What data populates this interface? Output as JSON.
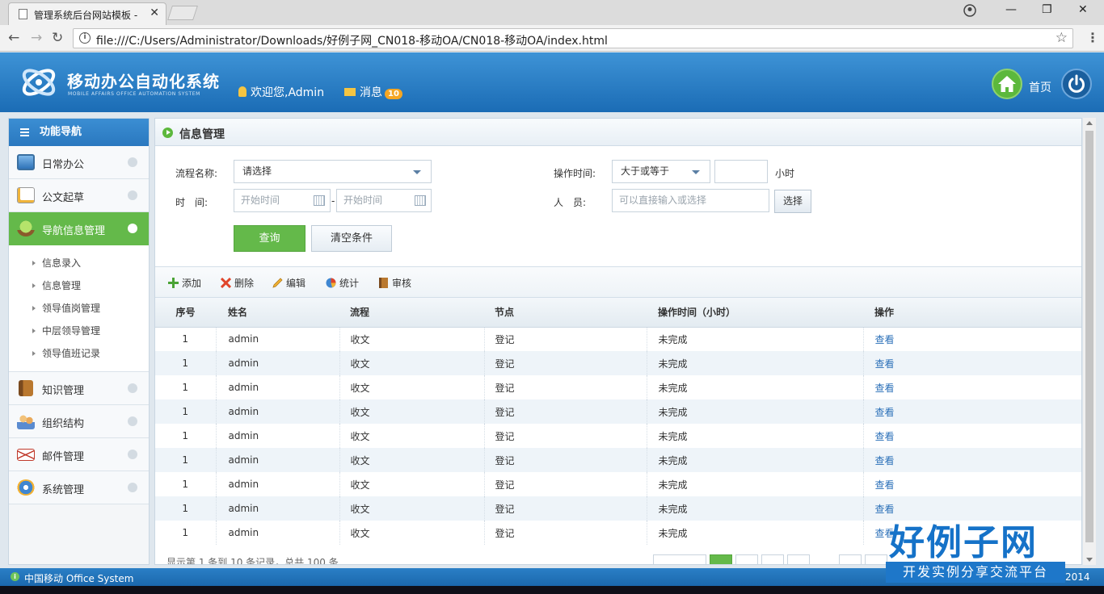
{
  "browser": {
    "tab_title": "管理系统后台网站模板 -",
    "url": "file:///C:/Users/Administrator/Downloads/好例子网_CN018-移动OA/CN018-移动OA/index.html"
  },
  "header": {
    "logo_title": "移动办公自动化系统",
    "logo_subtitle": "MOBILE AFFAIRS OFFICE AUTOMATION SYSTEM",
    "welcome": "欢迎您,Admin",
    "message_label": "消息",
    "message_count": "10",
    "home_label": "首页"
  },
  "sidebar": {
    "title": "功能导航",
    "items": [
      {
        "label": "日常办公",
        "icon": "monitor-icon"
      },
      {
        "label": "公文起草",
        "icon": "pencil-note-icon"
      },
      {
        "label": "导航信息管理",
        "icon": "tree-icon",
        "active": true
      },
      {
        "label": "知识管理",
        "icon": "book-icon"
      },
      {
        "label": "组织结构",
        "icon": "users-icon"
      },
      {
        "label": "邮件管理",
        "icon": "mail-icon"
      },
      {
        "label": "系统管理",
        "icon": "gear-icon"
      }
    ],
    "subitems": [
      "信息录入",
      "信息管理",
      "领导值岗管理",
      "中层领导管理",
      "领导值班记录"
    ]
  },
  "main": {
    "title": "信息管理",
    "form": {
      "flow_label": "流程名称:",
      "flow_value": "请选择",
      "time_label": "时　间:",
      "start_placeholder": "开始时间",
      "dash": "-",
      "end_placeholder": "开始时间",
      "optime_label": "操作时间:",
      "optime_value": "大于或等于",
      "hours_unit": "小时",
      "person_label": "人　员:",
      "person_placeholder": "可以直接输入或选择",
      "choose_button": "选择",
      "query_button": "查询",
      "clear_button": "清空条件"
    },
    "toolbar": {
      "add": "添加",
      "delete": "删除",
      "edit": "编辑",
      "stats": "统计",
      "review": "审核"
    },
    "table": {
      "headers": [
        "序号",
        "姓名",
        "流程",
        "节点",
        "操作时间（小时）",
        "操作"
      ],
      "rows": [
        {
          "no": "1",
          "name": "admin",
          "flow": "收文",
          "node": "登记",
          "time": "未完成",
          "op": "查看"
        },
        {
          "no": "1",
          "name": "admin",
          "flow": "收文",
          "node": "登记",
          "time": "未完成",
          "op": "查看"
        },
        {
          "no": "1",
          "name": "admin",
          "flow": "收文",
          "node": "登记",
          "time": "未完成",
          "op": "查看"
        },
        {
          "no": "1",
          "name": "admin",
          "flow": "收文",
          "node": "登记",
          "time": "未完成",
          "op": "查看"
        },
        {
          "no": "1",
          "name": "admin",
          "flow": "收文",
          "node": "登记",
          "time": "未完成",
          "op": "查看"
        },
        {
          "no": "1",
          "name": "admin",
          "flow": "收文",
          "node": "登记",
          "time": "未完成",
          "op": "查看"
        },
        {
          "no": "1",
          "name": "admin",
          "flow": "收文",
          "node": "登记",
          "time": "未完成",
          "op": "查看"
        },
        {
          "no": "1",
          "name": "admin",
          "flow": "收文",
          "node": "登记",
          "time": "未完成",
          "op": "查看"
        },
        {
          "no": "1",
          "name": "admin",
          "flow": "收文",
          "node": "登记",
          "time": "未完成",
          "op": "查看"
        }
      ]
    },
    "pager_info": "显示第 1 条到 10 条记录，总共 100 条"
  },
  "footer": {
    "text": "中国移动  Office System",
    "year": "2014"
  },
  "brand": {
    "big": "好例子网",
    "small": "开发实例分享交流平台"
  },
  "colors": {
    "header_blue": "#1b6cb5",
    "accent_green": "#64b94a",
    "link_blue": "#2a6fb8"
  }
}
